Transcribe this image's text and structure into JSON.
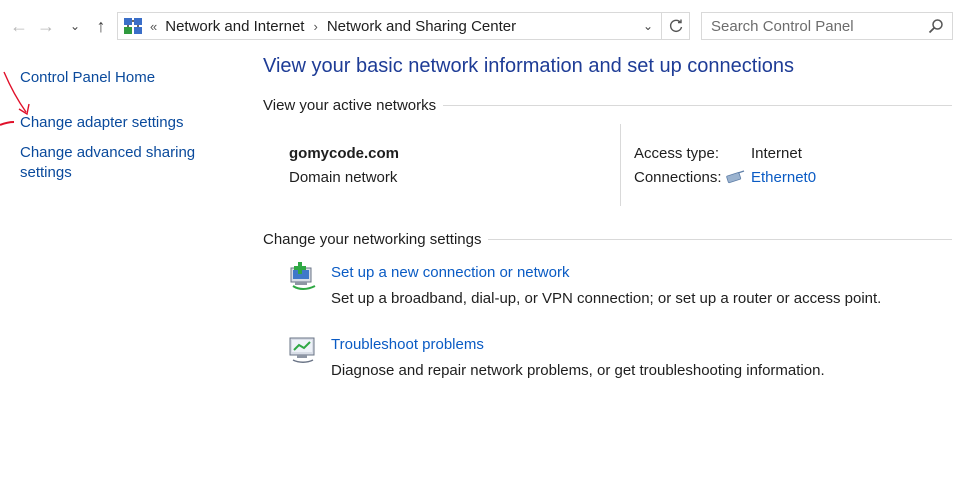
{
  "address_bar": {
    "breadcrumbs": [
      "Network and Internet",
      "Network and Sharing Center"
    ],
    "overflow_marker": "«"
  },
  "search": {
    "placeholder": "Search Control Panel"
  },
  "left_nav": {
    "items": [
      "Control Panel Home",
      "Change adapter settings",
      "Change advanced sharing settings"
    ]
  },
  "main": {
    "title": "View your basic network information and set up connections",
    "active_networks": {
      "heading": "View your active networks",
      "network_name": "gomycode.com",
      "network_category": "Domain network",
      "access_type_label": "Access type:",
      "access_type_value": "Internet",
      "connections_label": "Connections:",
      "connections_value": "Ethernet0"
    },
    "change_settings": {
      "heading": "Change your networking settings",
      "tasks": [
        {
          "link": "Set up a new connection or network",
          "description": "Set up a broadband, dial-up, or VPN connection; or set up a router or access point.",
          "icon": "new-connection-icon"
        },
        {
          "link": "Troubleshoot problems",
          "description": "Diagnose and repair network problems, or get troubleshooting information.",
          "icon": "troubleshoot-icon"
        }
      ]
    }
  },
  "colors": {
    "link": "#0a5bc4",
    "nav_link": "#0a4a9c",
    "title": "#1e3c96",
    "annotation": "#e0102a"
  }
}
